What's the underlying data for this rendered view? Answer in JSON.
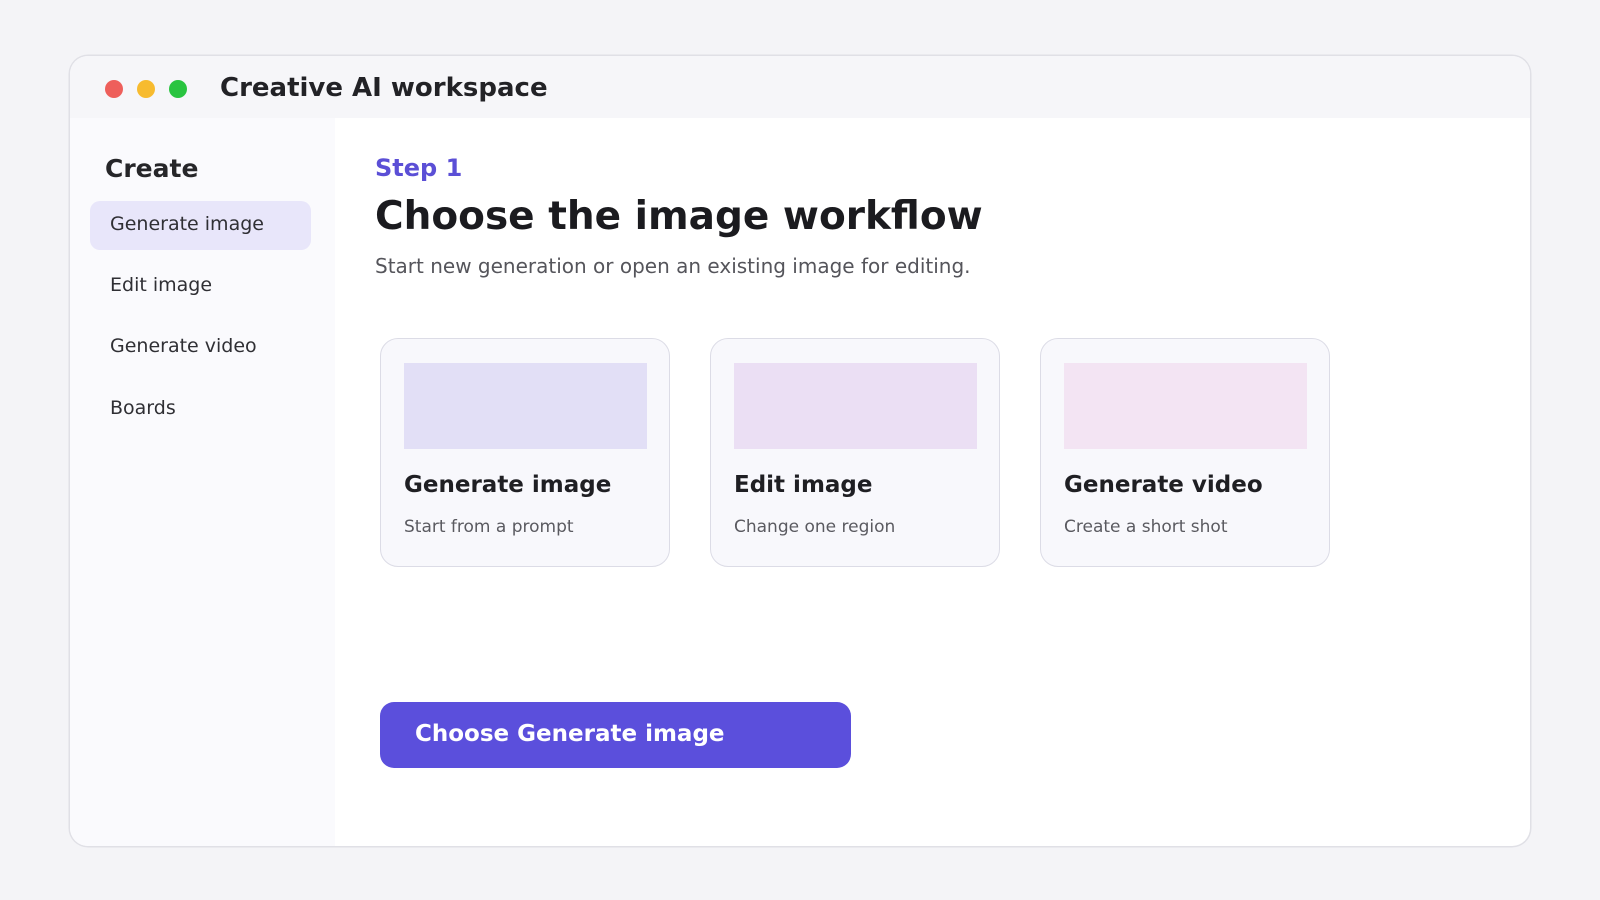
{
  "window": {
    "title": "Creative AI workspace",
    "controls": [
      {
        "name": "close",
        "color": "#ee5f5b"
      },
      {
        "name": "minimize",
        "color": "#f7bb2f"
      },
      {
        "name": "maximize",
        "color": "#29c440"
      }
    ]
  },
  "sidebar": {
    "heading": "Create",
    "items": [
      {
        "label": "Generate image",
        "active": true
      },
      {
        "label": "Edit image",
        "active": false
      },
      {
        "label": "Generate video",
        "active": false
      },
      {
        "label": "Boards",
        "active": false
      }
    ]
  },
  "main": {
    "step": "Step 1",
    "title": "Choose the image workflow",
    "subtitle": "Start new generation or open an existing image for editing.",
    "cards": [
      {
        "title": "Generate image",
        "description": "Start from a prompt",
        "thumb_color": "#e2dff6"
      },
      {
        "title": "Edit image",
        "description": "Change one region",
        "thumb_color": "#ebdff4"
      },
      {
        "title": "Generate video",
        "description": "Create a short shot",
        "thumb_color": "#f3e4f3"
      }
    ],
    "primary_button": "Choose Generate image"
  },
  "colors": {
    "accent": "#5b4fdc",
    "sidebar_active": "#e8e6fa",
    "background": "#f4f4f7"
  }
}
